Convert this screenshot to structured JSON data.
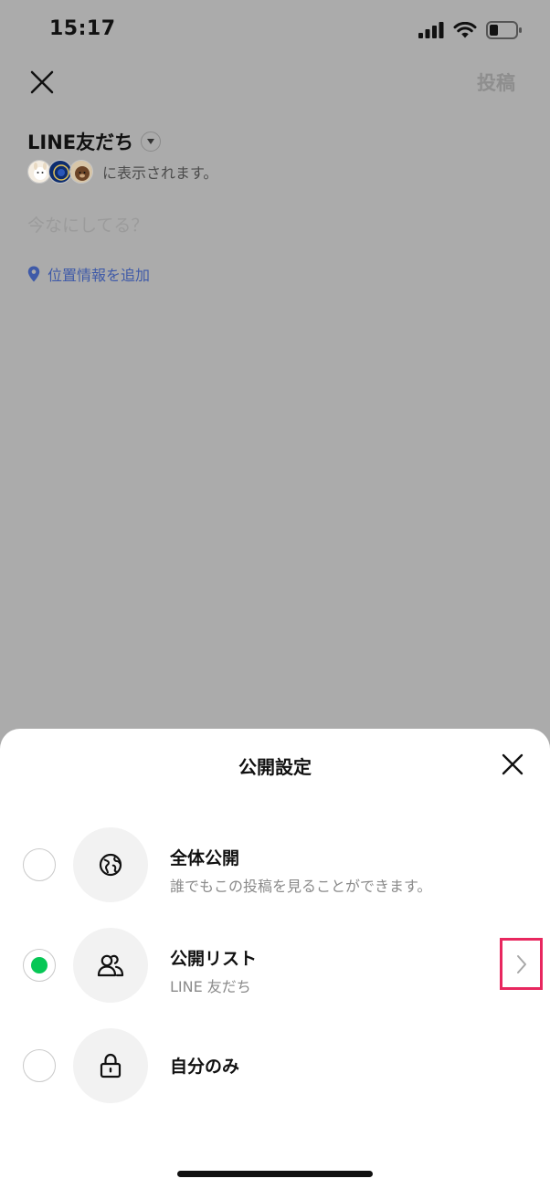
{
  "status_bar": {
    "time": "15:17",
    "icons": [
      "signal-icon",
      "wifi-icon",
      "battery-icon"
    ]
  },
  "header": {
    "close_icon": "close-icon",
    "post_label": "投稿"
  },
  "composer": {
    "audience_label": "LINE友だち",
    "visibility_text": "に表示されます。",
    "placeholder": "今なにしてる？",
    "location_label": "位置情報を追加"
  },
  "sheet": {
    "title": "公開設定",
    "options": [
      {
        "icon": "globe-icon",
        "title": "全体公開",
        "subtitle": "誰でもこの投稿を見ることができます。",
        "selected": false
      },
      {
        "icon": "people-icon",
        "title": "公開リスト",
        "subtitle": "LINE 友だち",
        "selected": true
      },
      {
        "icon": "lock-icon",
        "title": "自分のみ",
        "subtitle": "",
        "selected": false
      }
    ]
  },
  "colors": {
    "accent_green": "#06c755",
    "link_blue": "#3f5aa8",
    "highlight_pink": "#e8275f",
    "overlay_gray": "#ababab"
  }
}
